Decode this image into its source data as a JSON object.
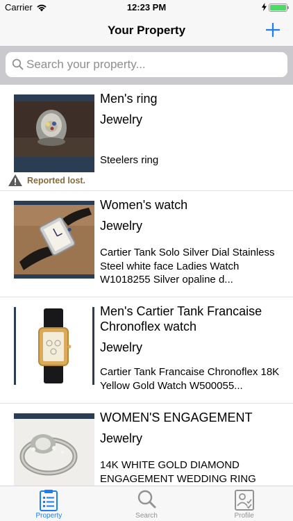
{
  "status_bar": {
    "carrier": "Carrier",
    "time": "12:23 PM"
  },
  "nav": {
    "title": "Your Property",
    "add_icon": "plus-icon"
  },
  "search": {
    "placeholder": "Search your property...",
    "value": ""
  },
  "items": [
    {
      "title": "Men's ring",
      "category": "Jewelry",
      "description": "Steelers ring",
      "status": "Reported lost."
    },
    {
      "title": "Women's watch",
      "category": "Jewelry",
      "description": "Cartier Tank Solo Silver Dial Stainless Steel white face Ladies Watch W1018255  Silver opaline d..."
    },
    {
      "title": "Men's Cartier Tank Francaise Chronoflex watch",
      "category": "Jewelry",
      "description": "Cartier Tank Francaise Chronoflex 18K Yellow Gold Watch W500055..."
    },
    {
      "title": "WOMEN'S ENGAGEMENT",
      "category": "Jewelry",
      "description": "14K WHITE GOLD DIAMOND ENGAGEMENT WEDDING RING"
    }
  ],
  "tabs": [
    {
      "label": "Property",
      "icon": "clipboard-list-icon",
      "selected": true
    },
    {
      "label": "Search",
      "icon": "magnifier-icon",
      "selected": false
    },
    {
      "label": "Profile",
      "icon": "profile-card-icon",
      "selected": false
    }
  ],
  "colors": {
    "accent": "#1a7ff5",
    "inactive": "#929292",
    "lost": "#8a6a3a",
    "search_bg": "#c9c9ce"
  }
}
